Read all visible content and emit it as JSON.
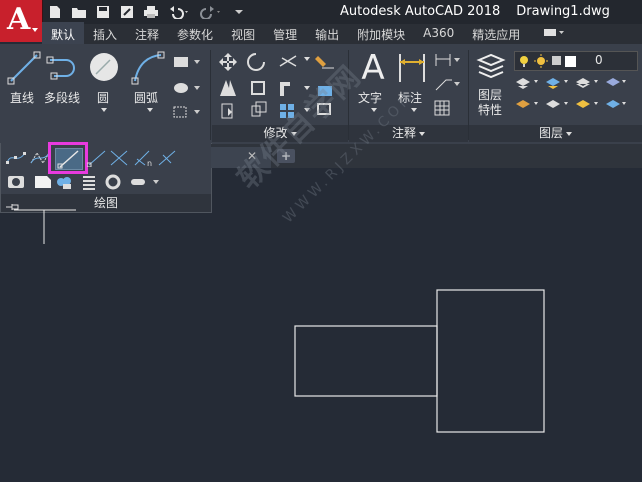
{
  "window": {
    "app_name": "Autodesk AutoCAD 2018",
    "file_name": "Drawing1.dwg"
  },
  "tabs": [
    "默认",
    "插入",
    "注释",
    "参数化",
    "视图",
    "管理",
    "输出",
    "附加模块",
    "A360",
    "精选应用"
  ],
  "active_tab": "默认",
  "draw_panel": {
    "tools": [
      "直线",
      "多段线",
      "圆",
      "圆弧"
    ],
    "title": "绘图"
  },
  "modify_panel": {
    "title": "修改"
  },
  "annotation_panel": {
    "tools": [
      "文字",
      "标注"
    ],
    "title": "注释"
  },
  "layers_panel": {
    "properties_label": "图层\n特性",
    "layer_value": "0",
    "title": "图层"
  },
  "watermark": {
    "main": "软件自学网",
    "sub": "WWW.RJZXW.COM"
  },
  "colors": {
    "accent_red": "#c8202c",
    "highlight": "#e83adf",
    "canvas": "#252b36"
  }
}
